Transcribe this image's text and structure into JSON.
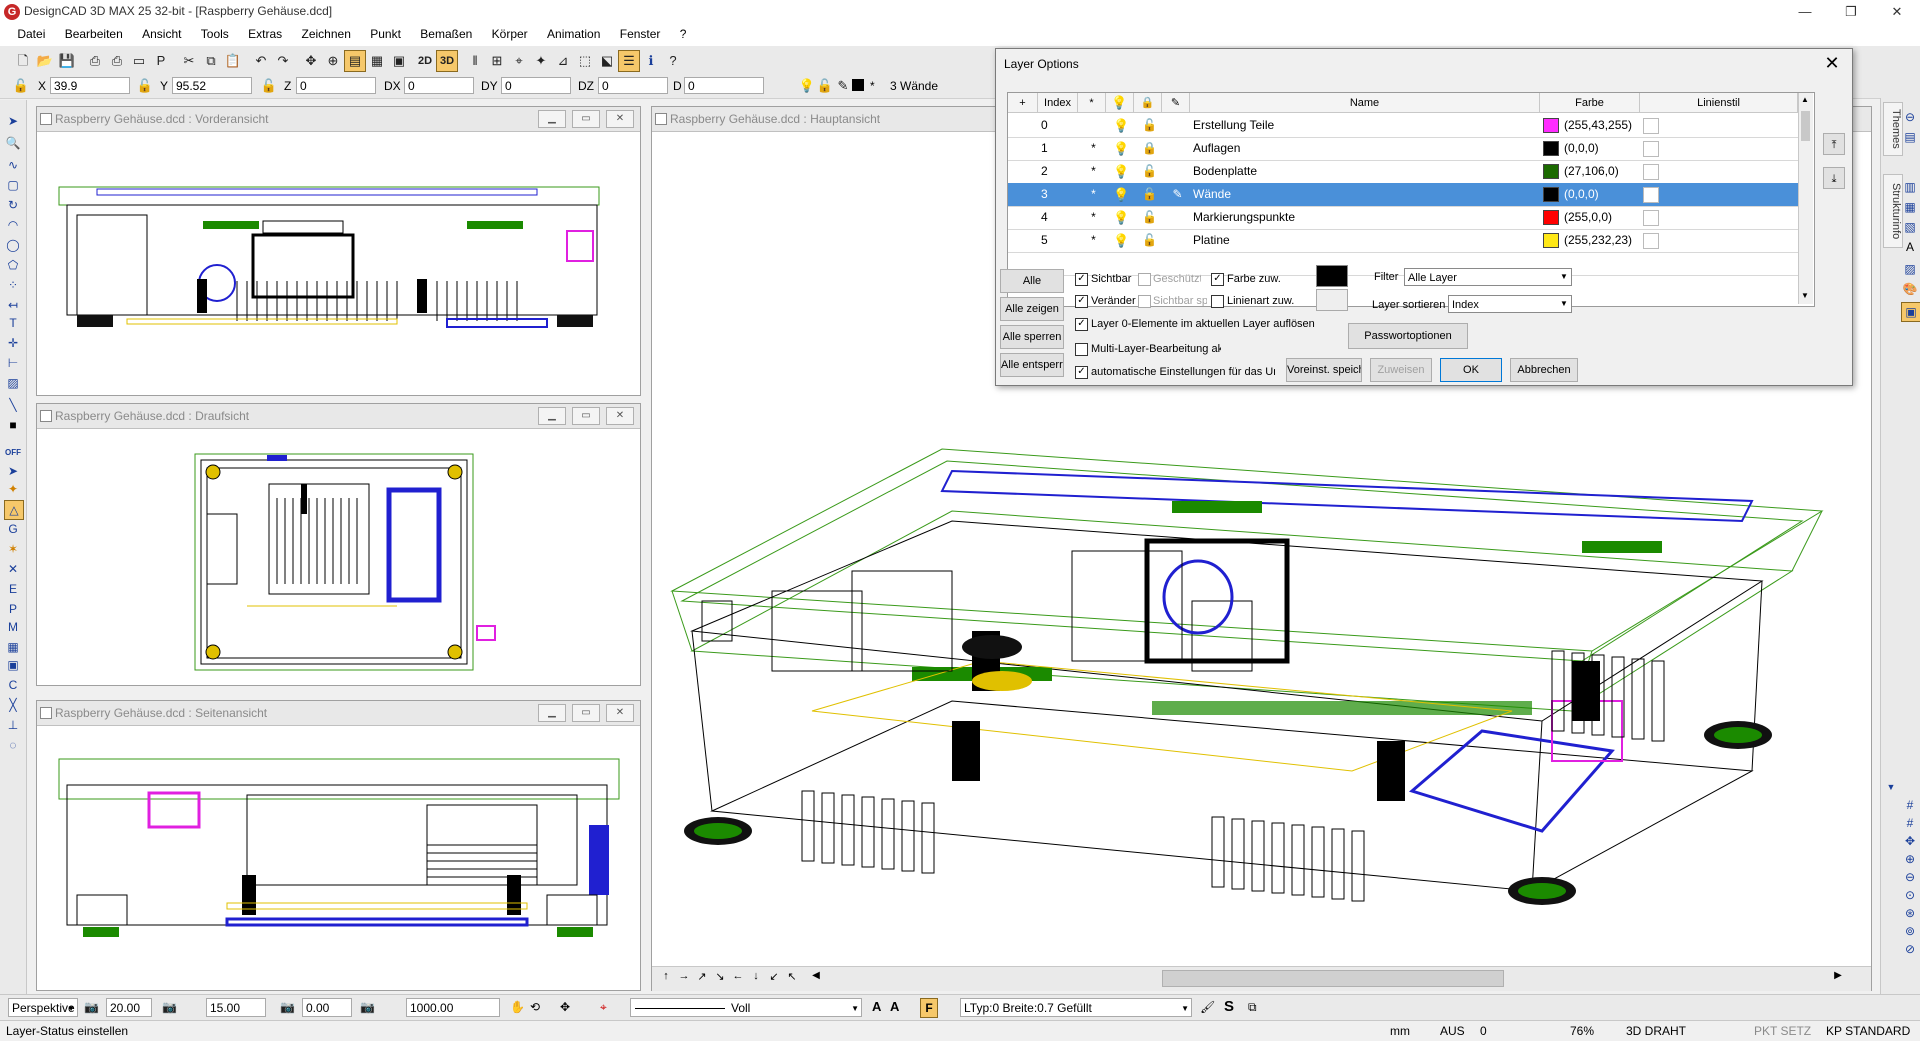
{
  "window": {
    "title": "DesignCAD 3D MAX 25 32-bit - [Raspberry Gehäuse.dcd]",
    "app_icon": "G",
    "controls": [
      "—",
      "❐",
      "✕"
    ]
  },
  "menu": [
    "Datei",
    "Bearbeiten",
    "Ansicht",
    "Tools",
    "Extras",
    "Zeichnen",
    "Punkt",
    "Bemaßen",
    "Körper",
    "Animation",
    "Fenster",
    "?"
  ],
  "toolbar": {
    "btn_2d": "2D",
    "btn_3d": "3D"
  },
  "coords": {
    "x_label": "X",
    "x_value": "39.9",
    "y_label": "Y",
    "y_value": "95.52",
    "z_label": "Z",
    "z_value": "0",
    "dx_label": "DX",
    "dx_value": "0",
    "dy_label": "DY",
    "dy_value": "0",
    "dz_label": "DZ",
    "dz_value": "0",
    "d_label": "D",
    "d_value": "0",
    "current_layer": "3  Wände"
  },
  "viewports": {
    "front": "Raspberry Gehäuse.dcd : Vorderansicht",
    "top": "Raspberry Gehäuse.dcd : Draufsicht",
    "side": "Raspberry Gehäuse.dcd : Seitenansicht",
    "main": "Raspberry Gehäuse.dcd : Hauptansicht"
  },
  "right_tabs": {
    "themes": "Themes",
    "struktur": "Strukturinfo"
  },
  "dialog": {
    "title": "Layer Options",
    "close": "✕",
    "headers": {
      "add": "+",
      "index": "Index",
      "star": "*",
      "name": "Name",
      "color": "Farbe",
      "style": "Linienstil"
    },
    "layers": [
      {
        "index": "0",
        "star": "",
        "name": "Erstellung Teile",
        "color_hex": "#ff2bff",
        "color_label": "(255,43,255)",
        "selected": false
      },
      {
        "index": "1",
        "star": "*",
        "name": "Auflagen",
        "color_hex": "#000000",
        "color_label": "(0,0,0)",
        "selected": false
      },
      {
        "index": "2",
        "star": "*",
        "name": "Bodenplatte",
        "color_hex": "#1b6a00",
        "color_label": "(27,106,0)",
        "selected": false
      },
      {
        "index": "3",
        "star": "*",
        "name": "Wände",
        "color_hex": "#000000",
        "color_label": "(0,0,0)",
        "selected": true
      },
      {
        "index": "4",
        "star": "*",
        "name": "Markierungspunkte",
        "color_hex": "#ff0000",
        "color_label": "(255,0,0)",
        "selected": false
      },
      {
        "index": "5",
        "star": "*",
        "name": "Platine",
        "color_hex": "#ffe817",
        "color_label": "(255,232,23)",
        "selected": false
      }
    ],
    "left_buttons": [
      "Alle verstecken",
      "Alle zeigen",
      "Alle sperren",
      "Alle entsperren"
    ],
    "checks": {
      "sichtbar": "Sichtbar",
      "geschuetzt": "Geschützt",
      "farbe_zuw": "Farbe zuw.",
      "veraender": "Veränderbar",
      "sichtbar_sp": "Sichtbar sperren",
      "linienart_zuw": "Linienart zuw.",
      "layer0": "Layer 0-Elemente im aktuellen Layer auflösen",
      "multi": "Multi-Layer-Bearbeitung aktivieren",
      "auto": "automatische Einstellungen für das Umschalten"
    },
    "filter_label": "Filter",
    "filter_value": "Alle Layer",
    "sort_label": "Layer sortieren",
    "sort_value": "Index",
    "password_btn": "Passwortoptionen",
    "save_default_btn": "Voreinst. speichern",
    "assign_btn": "Zuweisen",
    "ok_btn": "OK",
    "cancel_btn": "Abbrechen"
  },
  "bottom": {
    "view_mode": "Perspektive",
    "v1": "20.00",
    "v2": "15.00",
    "v3": "0.00",
    "v4": "1000.00",
    "line_style": "Voll",
    "line_info": "LTyp:0  Breite:0.7  Gefüllt"
  },
  "status": {
    "message": "Layer-Status einstellen",
    "unit": "mm",
    "aus": "AUS",
    "zero": "0",
    "zoom": "76%",
    "mode": "3D DRAHT",
    "pkt": "PKT SETZ",
    "kp": "KP STANDARD"
  }
}
